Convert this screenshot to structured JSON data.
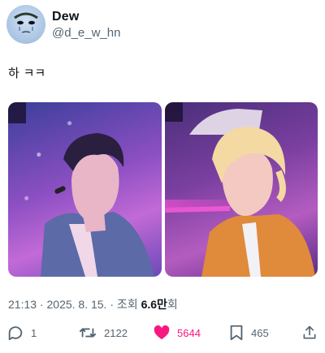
{
  "author": {
    "display_name": "Dew",
    "handle": "@d_e_w_hn"
  },
  "tweet": {
    "text": "하 ㅋㅋ"
  },
  "meta": {
    "time": "21:13",
    "separator1": " · ",
    "date": "2025. 8. 15.",
    "separator2": " · ",
    "views_label": "조회 ",
    "views_value": "6.6만",
    "views_suffix": "회"
  },
  "actions": {
    "reply_count": "1",
    "retweet_count": "2122",
    "like_count": "5644",
    "bookmark_count": "465"
  },
  "icons": {
    "reply": "reply-icon",
    "retweet": "retweet-icon",
    "like": "heart-icon",
    "bookmark": "bookmark-icon",
    "share": "share-icon"
  },
  "colors": {
    "like": "#f91880",
    "secondary_text": "#536471",
    "primary_text": "#0f1419"
  }
}
